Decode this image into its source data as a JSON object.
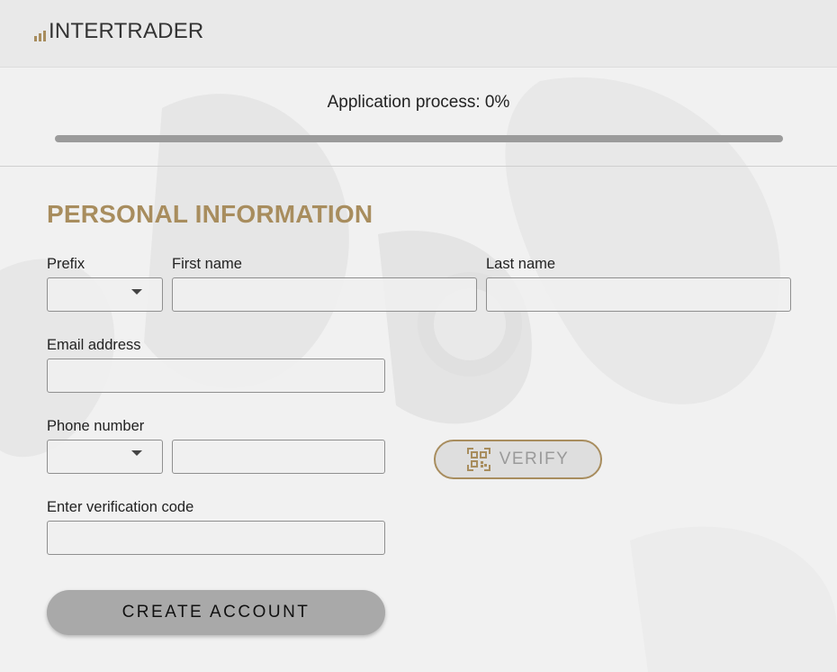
{
  "brand": {
    "name": "INTERTRADER",
    "accent_color": "#a88d5e"
  },
  "progress": {
    "label": "Application process: 0%",
    "value": 0
  },
  "form": {
    "section_title": "PERSONAL INFORMATION",
    "prefix_label": "Prefix",
    "first_name_label": "First name",
    "last_name_label": "Last name",
    "email_label": "Email address",
    "phone_label": "Phone number",
    "verification_label": "Enter verification code",
    "prefix_value": "",
    "first_name_value": "",
    "last_name_value": "",
    "email_value": "",
    "phone_code_value": "",
    "phone_value": "",
    "verification_value": ""
  },
  "buttons": {
    "verify_label": "VERIFY",
    "verify_icon": "qr-code-icon",
    "create_label": "CREATE ACCOUNT"
  }
}
